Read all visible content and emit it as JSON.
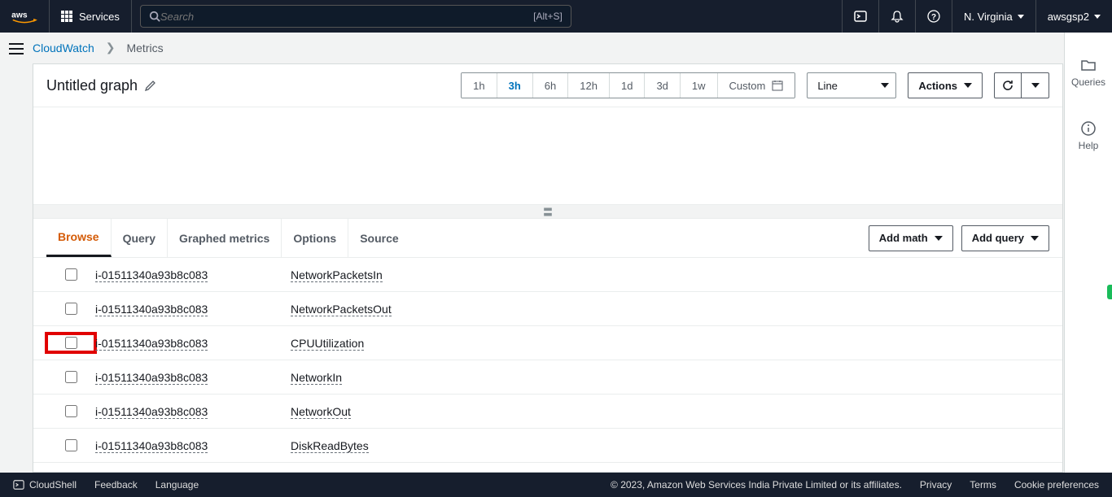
{
  "topnav": {
    "services_label": "Services",
    "search_placeholder": "Search",
    "search_shortcut": "[Alt+S]",
    "region": "N. Virginia",
    "account": "awsgsp2"
  },
  "breadcrumbs": {
    "root": "CloudWatch",
    "current": "Metrics"
  },
  "graph": {
    "title": "Untitled graph",
    "time_options": [
      "1h",
      "3h",
      "6h",
      "12h",
      "1d",
      "3d",
      "1w"
    ],
    "time_selected": "3h",
    "custom_label": "Custom",
    "chart_type": "Line",
    "actions_label": "Actions",
    "add_math": "Add math",
    "add_query": "Add query"
  },
  "tabs": {
    "browse": "Browse",
    "query": "Query",
    "graphed": "Graphed metrics",
    "options": "Options",
    "source": "Source"
  },
  "metrics": [
    {
      "instance": "i-01511340a93b8c083",
      "name": "NetworkPacketsIn",
      "highlight": false
    },
    {
      "instance": "i-01511340a93b8c083",
      "name": "NetworkPacketsOut",
      "highlight": false
    },
    {
      "instance": "i-01511340a93b8c083",
      "name": "CPUUtilization",
      "highlight": true
    },
    {
      "instance": "i-01511340a93b8c083",
      "name": "NetworkIn",
      "highlight": false
    },
    {
      "instance": "i-01511340a93b8c083",
      "name": "NetworkOut",
      "highlight": false
    },
    {
      "instance": "i-01511340a93b8c083",
      "name": "DiskReadBytes",
      "highlight": false
    }
  ],
  "right_panel": {
    "queries": "Queries",
    "help": "Help"
  },
  "footer": {
    "cloudshell": "CloudShell",
    "feedback": "Feedback",
    "language": "Language",
    "copyright": "© 2023, Amazon Web Services India Private Limited or its affiliates.",
    "privacy": "Privacy",
    "terms": "Terms",
    "cookies": "Cookie preferences"
  }
}
